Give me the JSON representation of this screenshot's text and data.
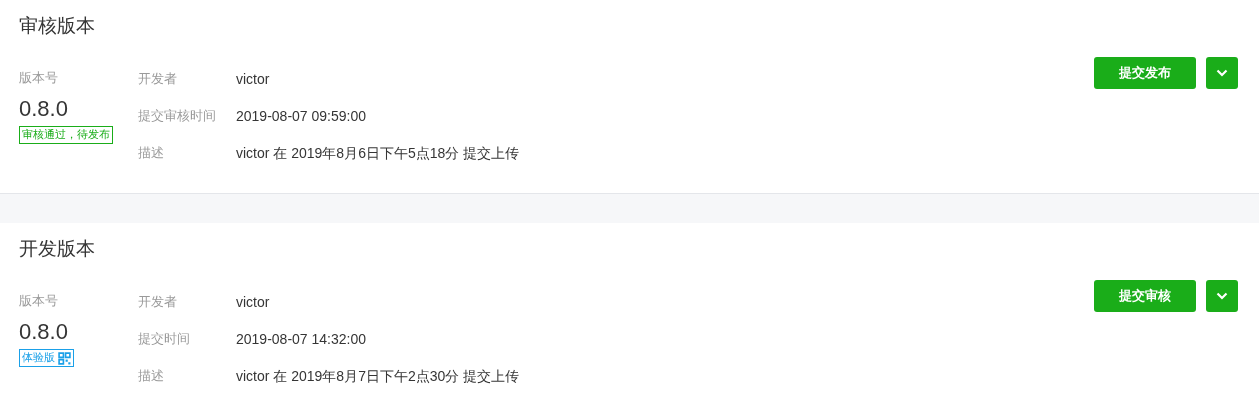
{
  "sections": [
    {
      "title": "审核版本",
      "version_label": "版本号",
      "version": "0.8.0",
      "badge": {
        "kind": "status",
        "text": "审核通过，待发布"
      },
      "fields": [
        {
          "label": "开发者",
          "value": "victor"
        },
        {
          "label": "提交审核时间",
          "value": "2019-08-07 09:59:00"
        },
        {
          "label": "描述",
          "value": "victor 在 2019年8月6日下午5点18分 提交上传"
        }
      ],
      "button": "提交发布"
    },
    {
      "title": "开发版本",
      "version_label": "版本号",
      "version": "0.8.0",
      "badge": {
        "kind": "trial",
        "text": "体验版"
      },
      "fields": [
        {
          "label": "开发者",
          "value": "victor"
        },
        {
          "label": "提交时间",
          "value": "2019-08-07 14:32:00"
        },
        {
          "label": "描述",
          "value": "victor 在 2019年8月7日下午2点30分 提交上传"
        }
      ],
      "button": "提交审核"
    }
  ]
}
